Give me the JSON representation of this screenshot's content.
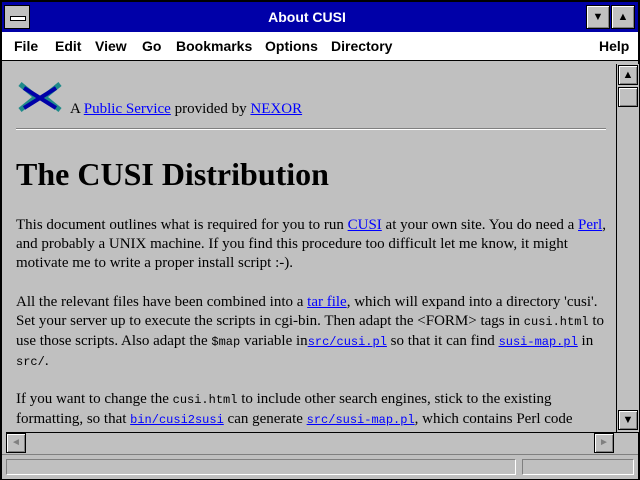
{
  "window": {
    "title": "About CUSI",
    "minimize_glyph": "▼",
    "maximize_glyph": "▲"
  },
  "menu": {
    "file": "File",
    "edit": "Edit",
    "view": "View",
    "go": "Go",
    "bookmarks": "Bookmarks",
    "options": "Options",
    "directory": "Directory",
    "help": "Help"
  },
  "header": {
    "prefix": "A",
    "public_service": "Public Service",
    "provided_by": "provided by",
    "nexor": "NEXOR"
  },
  "doc": {
    "heading": "The CUSI Distribution",
    "p1": {
      "t1": "This document outlines what is required for you to run",
      "cusi": "CUSI",
      "t2": "at your own site. You do need a",
      "perl": "Perl",
      "t3": ", and probably a UNIX machine. If you find this procedure too difficult let me know, it might motivate me to write a proper install script :-)."
    },
    "p2": {
      "t1": "All the relevant files have been combined into a",
      "tar": "tar file",
      "t2": ", which will expand into a directory 'cusi'. Set your server up to execute the scripts in cgi-bin. Then adapt the <FORM> tags in",
      "cusi_html": "cusi.html",
      "t3": "to use those scripts. Also adapt the",
      "map_var": "$map",
      "t4": "variable in",
      "src_cusi": "src/cusi.pl",
      "t5": "so that it can find",
      "susi_map": "susi-map.pl",
      "t6": "in",
      "src_dir": "src/",
      "t7": "."
    },
    "p3": {
      "t1": "If you want to change the",
      "cusi_html": "cusi.html",
      "t2": "to include other search engines, stick to the existing formatting, so that",
      "bin": "bin/cusi2susi",
      "t3": "can generate",
      "src_susi": "src/susi-map.pl",
      "t4": ", which contains Perl code"
    }
  },
  "scrollbar": {
    "up": "▲",
    "down": "▼",
    "left": "◄",
    "right": "►"
  },
  "colors": {
    "titlebar": "#0000a8",
    "link": "#0000ff",
    "background": "#c0c0c0"
  }
}
